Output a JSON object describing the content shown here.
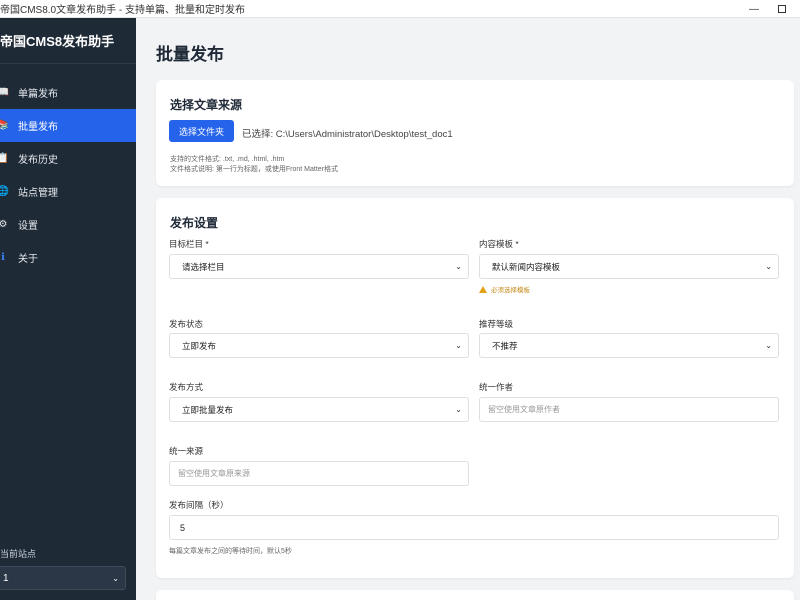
{
  "window": {
    "title": "帝国CMS8.0文章发布助手 - 支持单篇、批量和定时发布"
  },
  "sidebar": {
    "brand": "帝国CMS8发布助手",
    "items": [
      {
        "label": "单篇发布",
        "icon": "book-icon",
        "glyph": "📖"
      },
      {
        "label": "批量发布",
        "icon": "books-icon",
        "glyph": "📚"
      },
      {
        "label": "发布历史",
        "icon": "clipboard-icon",
        "glyph": "📋"
      },
      {
        "label": "站点管理",
        "icon": "globe-icon",
        "glyph": "🌐"
      },
      {
        "label": "设置",
        "icon": "gear-icon",
        "glyph": "⚙"
      },
      {
        "label": "关于",
        "icon": "info-icon",
        "glyph": "ℹ"
      }
    ],
    "active_index": 1,
    "site_label": "当前站点",
    "site_value": "1"
  },
  "main": {
    "page_title": "批量发布",
    "source": {
      "title": "选择文章来源",
      "button": "选择文件夹",
      "selected_path": "已选择: C:\\Users\\Administrator\\Desktop\\test_doc1",
      "help1": "支持的文件格式: .txt, .md, .html, .htm",
      "help2": "文件格式说明: 第一行为标题，或使用Front Matter格式"
    },
    "settings": {
      "title": "发布设置",
      "target_column_label": "目标栏目 *",
      "target_column_value": "请选择栏目",
      "template_label": "内容模板 *",
      "template_value": "默认新闻内容模板",
      "template_warning": "必须选择模板",
      "status_label": "发布状态",
      "status_value": "立即发布",
      "recommend_label": "推荐等级",
      "recommend_value": "不推荐",
      "mode_label": "发布方式",
      "mode_value": "立即批量发布",
      "author_label": "统一作者",
      "author_placeholder": "留空使用文章原作者",
      "source_label": "统一来源",
      "source_placeholder": "留空使用文章原来源",
      "interval_label": "发布间隔（秒）",
      "interval_value": "5",
      "interval_note": "每篇文章发布之间的等待时间，默认5秒"
    }
  },
  "colors": {
    "sidebar_bg": "#1f2a37",
    "accent": "#2563eb",
    "warning": "#e0a213"
  }
}
